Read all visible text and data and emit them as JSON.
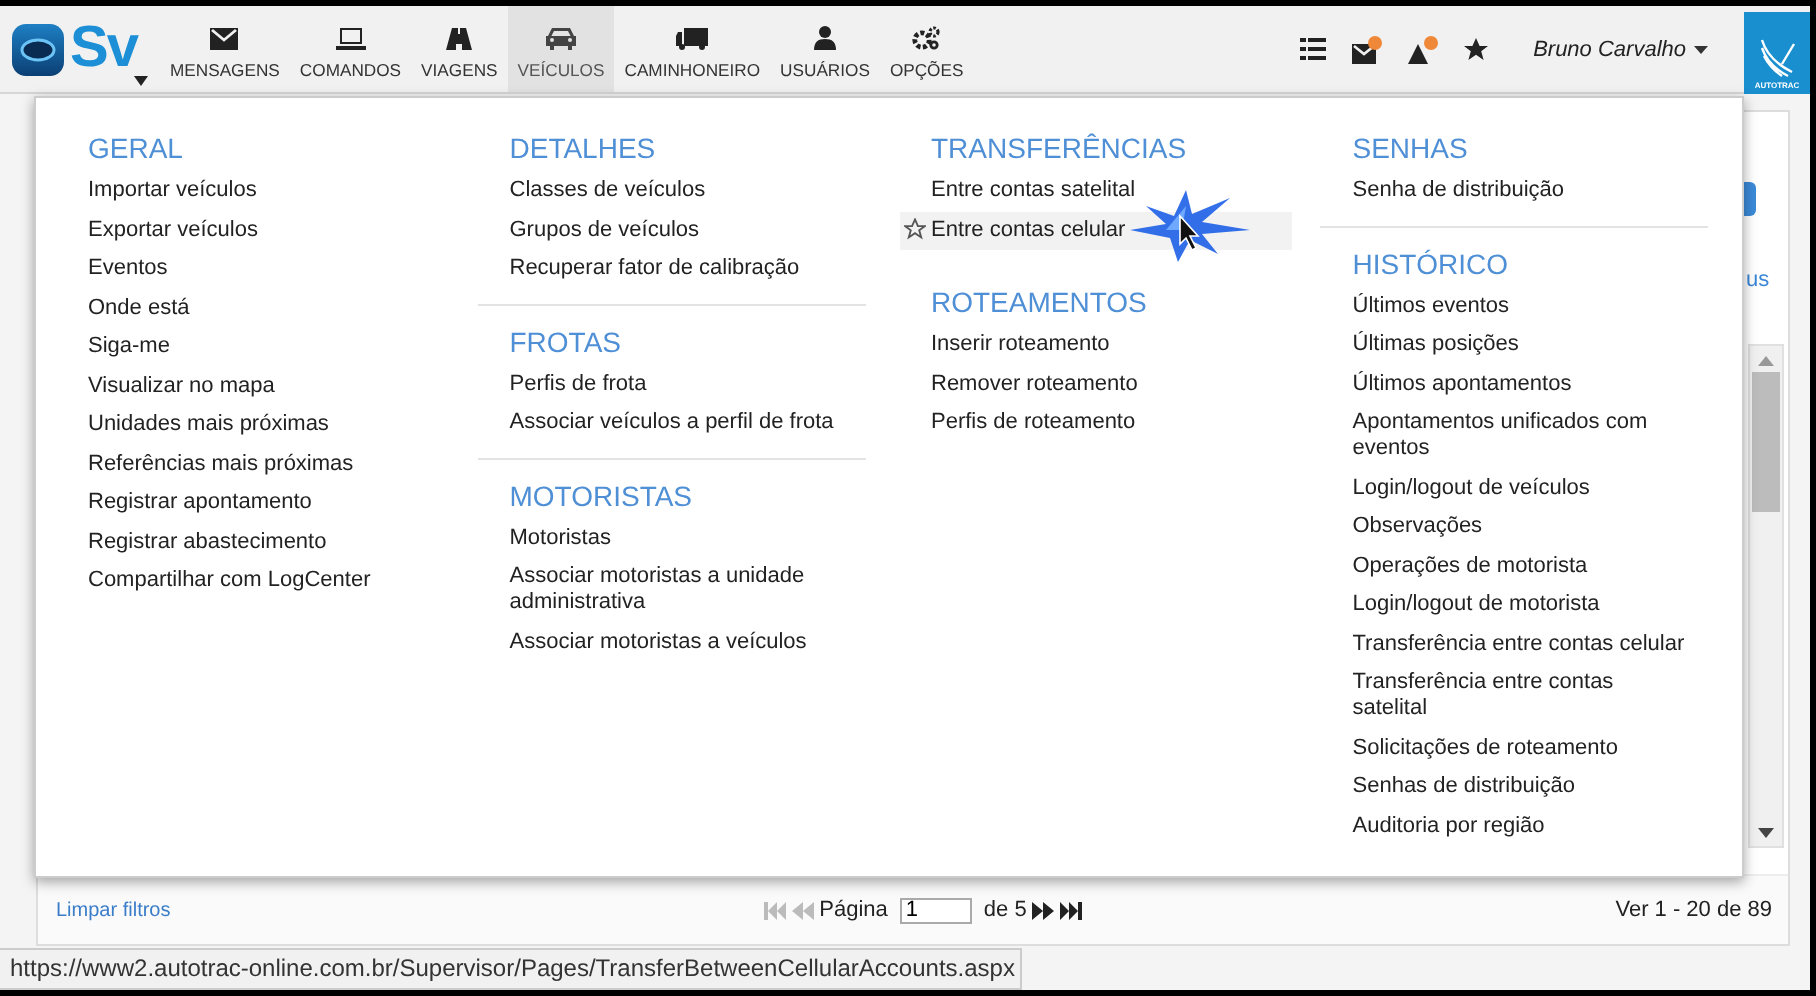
{
  "nav": {
    "logo_text": "Sv",
    "items": [
      {
        "label": "MENSAGENS",
        "kind": "envelope",
        "selected": false
      },
      {
        "label": "COMANDOS",
        "kind": "laptop",
        "selected": false
      },
      {
        "label": "VIAGENS",
        "kind": "road",
        "selected": false
      },
      {
        "label": "VEÍCULOS",
        "kind": "car",
        "selected": true
      },
      {
        "label": "CAMINHONEIRO",
        "kind": "truck",
        "selected": false
      },
      {
        "label": "USUÁRIOS",
        "kind": "user",
        "selected": false
      },
      {
        "label": "OPÇÕES",
        "kind": "gears",
        "selected": false
      }
    ],
    "user": "Bruno Carvalho",
    "brand": "AUTOTRAC"
  },
  "menu": {
    "columns": [
      {
        "sections": [
          {
            "title": "GERAL",
            "divider_above": false,
            "items": [
              {
                "label": "Importar veículos",
                "hovered": false
              },
              {
                "label": "Exportar veículos",
                "hovered": false
              },
              {
                "label": "Eventos",
                "hovered": false
              },
              {
                "label": "Onde está",
                "hovered": false
              },
              {
                "label": "Siga-me",
                "hovered": false
              },
              {
                "label": "Visualizar no mapa",
                "hovered": false
              },
              {
                "label": "Unidades mais próximas",
                "hovered": false
              },
              {
                "label": "Referências mais próximas",
                "hovered": false
              },
              {
                "label": "Registrar apontamento",
                "hovered": false
              },
              {
                "label": "Registrar abastecimento",
                "hovered": false
              },
              {
                "label": "Compartilhar com LogCenter",
                "hovered": false
              }
            ]
          }
        ]
      },
      {
        "sections": [
          {
            "title": "DETALHES",
            "divider_above": false,
            "items": [
              {
                "label": "Classes de veículos",
                "hovered": false
              },
              {
                "label": "Grupos de veículos",
                "hovered": false
              },
              {
                "label": "Recuperar fator de calibração",
                "hovered": false
              }
            ]
          },
          {
            "title": "FROTAS",
            "divider_above": true,
            "items": [
              {
                "label": "Perfis de frota",
                "hovered": false
              },
              {
                "label": "Associar veículos a perfil de frota",
                "hovered": false
              }
            ]
          },
          {
            "title": "MOTORISTAS",
            "divider_above": true,
            "items": [
              {
                "label": "Motoristas",
                "hovered": false
              },
              {
                "label": "Associar motoristas a unidade administrativa",
                "hovered": false
              },
              {
                "label": "Associar motoristas a veículos",
                "hovered": false
              }
            ]
          }
        ]
      },
      {
        "sections": [
          {
            "title": "TRANSFERÊNCIAS",
            "divider_above": false,
            "items": [
              {
                "label": "Entre contas satelital",
                "hovered": false
              },
              {
                "label": "Entre contas celular",
                "hovered": true
              }
            ]
          },
          {
            "title": "ROTEAMENTOS",
            "divider_above": false,
            "items": [
              {
                "label": "Inserir roteamento",
                "hovered": false
              },
              {
                "label": "Remover roteamento",
                "hovered": false
              },
              {
                "label": "Perfis de roteamento",
                "hovered": false
              }
            ]
          }
        ]
      },
      {
        "sections": [
          {
            "title": "SENHAS",
            "divider_above": false,
            "items": [
              {
                "label": "Senha de distribuição",
                "hovered": false
              }
            ]
          },
          {
            "title": "HISTÓRICO",
            "divider_above": true,
            "items": [
              {
                "label": "Últimos eventos",
                "hovered": false
              },
              {
                "label": "Últimas posições",
                "hovered": false
              },
              {
                "label": "Últimos apontamentos",
                "hovered": false
              },
              {
                "label": "Apontamentos unificados com eventos",
                "hovered": false
              },
              {
                "label": "Login/logout de veículos",
                "hovered": false
              },
              {
                "label": "Observações",
                "hovered": false
              },
              {
                "label": "Operações de motorista",
                "hovered": false
              },
              {
                "label": "Login/logout de motorista",
                "hovered": false
              },
              {
                "label": "Transferência entre contas celular",
                "hovered": false
              },
              {
                "label": "Transferência entre contas satelital",
                "hovered": false
              },
              {
                "label": "Solicitações de roteamento",
                "hovered": false
              },
              {
                "label": "Senhas de distribuição",
                "hovered": false
              },
              {
                "label": "Auditoria por região",
                "hovered": false
              }
            ]
          }
        ]
      }
    ]
  },
  "background": {
    "link_fragment": "us"
  },
  "footer": {
    "clear_filters": "Limpar filtros",
    "page_label": "Página",
    "page_value": "1",
    "page_total": "de 5",
    "summary": "Ver 1 - 20 de 89"
  },
  "status_url": "https://www2.autotrac-online.com.br/Supervisor/Pages/TransferBetweenCellularAccounts.aspx"
}
